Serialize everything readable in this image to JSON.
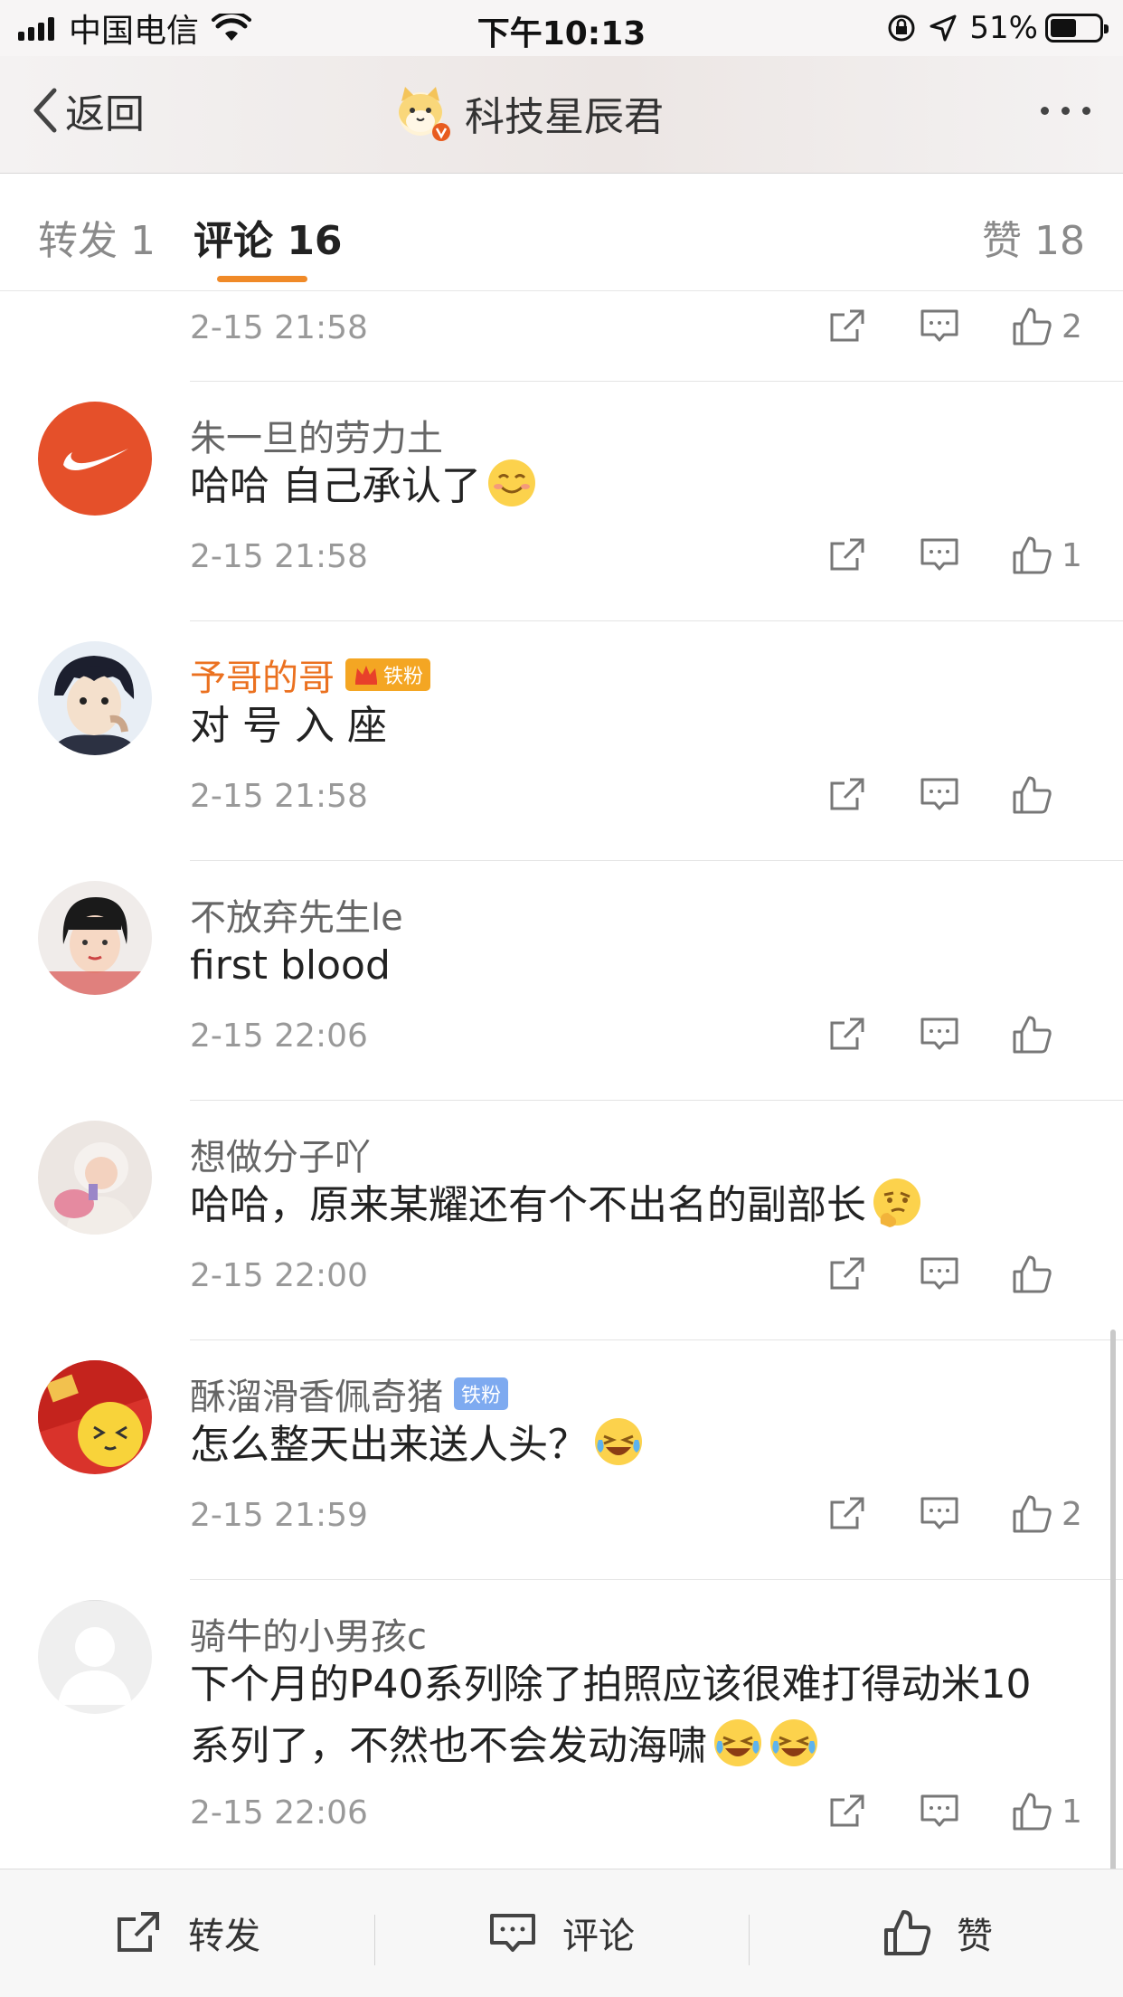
{
  "status_bar": {
    "carrier": "中国电信",
    "time": "下午10:13",
    "battery": "51%"
  },
  "nav": {
    "back_label": "返回",
    "title": "科技星辰君"
  },
  "tabs": {
    "repost": "转发 1",
    "comment": "评论 16",
    "like": "赞 18"
  },
  "comments": [
    {
      "user": "",
      "text": "",
      "time": "2-15 21:58",
      "likes": "2"
    },
    {
      "user": "朱一旦的劳力土",
      "text": "哈哈 自己承认了",
      "time": "2-15 21:58",
      "likes": "1",
      "emoji": [
        "smile"
      ]
    },
    {
      "user": "予哥的哥",
      "badge": "铁粉",
      "text": "对 号 入 座",
      "time": "2-15 21:58",
      "likes": ""
    },
    {
      "user": "不放弃先生le",
      "text": "first blood",
      "time": "2-15 22:06",
      "likes": ""
    },
    {
      "user": "想做分子吖",
      "text": "哈哈，原来某耀还有个不出名的副部长",
      "time": "2-15 22:00",
      "likes": "",
      "emoji": [
        "think"
      ]
    },
    {
      "user": "酥溜滑香佩奇猪",
      "badge": "铁粉",
      "text": "怎么整天出来送人头？",
      "time": "2-15 21:59",
      "likes": "2",
      "emoji": [
        "laugh"
      ]
    },
    {
      "user": "骑牛的小男孩c",
      "text_line1": "下个月的P40系列除了拍照应该很难打得动米10",
      "text_line2": "系列了，不然也不会发动海啸",
      "time": "2-15 22:06",
      "likes": "1",
      "emoji": [
        "laugh",
        "laugh"
      ]
    }
  ],
  "bottom_bar": {
    "repost": "转发",
    "comment": "评论",
    "like": "赞"
  },
  "colors": {
    "accent_orange": "#f08a28",
    "vip_name": "#eb7120",
    "badge_gold": "#f4a623",
    "badge_blue": "#7eaaf0"
  },
  "icons": [
    "back-chevron-icon",
    "more-icon",
    "repost-icon",
    "comment-icon",
    "like-icon",
    "wifi-icon",
    "location-icon",
    "lock-rotation-icon",
    "battery-icon"
  ]
}
